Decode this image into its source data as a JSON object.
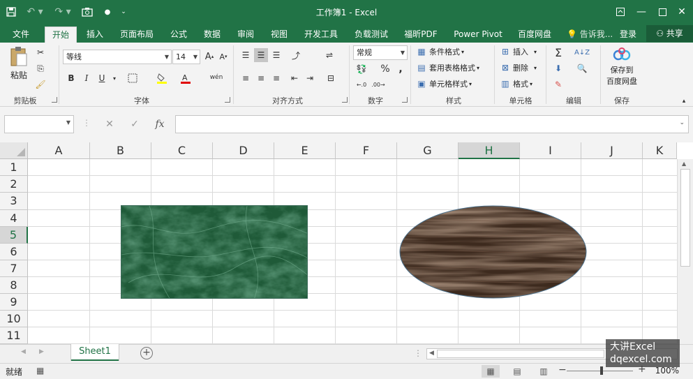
{
  "titlebar": {
    "title": "工作簿1 - Excel",
    "qa": {
      "save_icon": "save-icon",
      "undo_icon": "undo-icon",
      "redo_icon": "redo-icon",
      "camera_icon": "camera-icon"
    },
    "win": {
      "ribbon_display": "ribbon-display-icon",
      "minimize": "minimize-icon",
      "restore": "restore-icon",
      "close": "close-icon"
    }
  },
  "tabs": {
    "items": [
      "文件",
      "开始",
      "插入",
      "页面布局",
      "公式",
      "数据",
      "审阅",
      "视图",
      "开发工具",
      "负载测试",
      "福昕PDF",
      "Power Pivot",
      "百度网盘"
    ],
    "active": "开始",
    "tell_me": "告诉我...",
    "login": "登录",
    "share": "共享"
  },
  "ribbon": {
    "clipboard": {
      "paste": "粘贴",
      "label": "剪贴板"
    },
    "font": {
      "name": "等线",
      "size": "14",
      "label": "字体",
      "bold": "B",
      "italic": "I",
      "underline": "U",
      "increase": "A",
      "decrease": "A",
      "phonetic": "wén"
    },
    "alignment": {
      "label": "对齐方式"
    },
    "number": {
      "format": "常规",
      "percent": "%",
      "comma": ",",
      "label": "数字"
    },
    "styles": {
      "conditional": "条件格式",
      "table": "套用表格格式",
      "cell": "单元格样式",
      "label": "样式"
    },
    "cells": {
      "insert": "插入",
      "delete": "删除",
      "format": "格式",
      "label": "单元格"
    },
    "editing": {
      "label": "编辑"
    },
    "save": {
      "btn": "保存到",
      "btn2": "百度网盘",
      "label": "保存"
    }
  },
  "formula_bar": {
    "name_box": "",
    "cancel": "✕",
    "enter": "✓",
    "fx": "fx",
    "content": ""
  },
  "grid": {
    "columns": [
      "A",
      "B",
      "C",
      "D",
      "E",
      "F",
      "G",
      "H",
      "I",
      "J",
      "K"
    ],
    "rows": [
      "1",
      "2",
      "3",
      "4",
      "5",
      "6",
      "7",
      "8",
      "9",
      "10",
      "11"
    ],
    "selected_column": "H",
    "selected_row": "5",
    "shapes": {
      "rect_fill": "#1f5a38",
      "ellipse_fill": "#3d2a1e"
    }
  },
  "sheets": {
    "tabs": [
      "Sheet1"
    ],
    "active": "Sheet1"
  },
  "status": {
    "ready": "就绪",
    "zoom": "100%"
  },
  "watermark": {
    "line1": "大讲Excel",
    "line2": "dqexcel.com"
  }
}
